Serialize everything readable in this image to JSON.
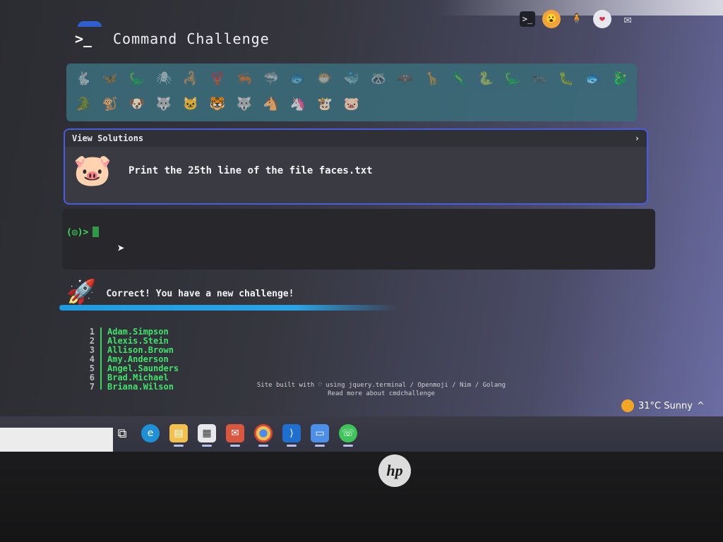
{
  "app": {
    "title": "Command Challenge",
    "logo_glyph": ">_"
  },
  "header_icons": [
    {
      "name": "terminal-icon",
      "glyph": ">_"
    },
    {
      "name": "face-emoji-icon",
      "glyph": "😮"
    },
    {
      "name": "figure-icon",
      "glyph": "🧍"
    },
    {
      "name": "heart-icon",
      "glyph": "❤"
    },
    {
      "name": "mail-icon",
      "glyph": "✉"
    }
  ],
  "emoji_bar": {
    "row1": [
      "🐇",
      "🦋",
      "🦕",
      "🕷",
      "🦂",
      "🦞",
      "🦐",
      "🦈",
      "🐟",
      "🐡",
      "🐳",
      "🦝",
      "🦇",
      "🦒",
      "🦎",
      "🐍",
      "🦕",
      "🐜",
      "🐛",
      "🐟",
      "🐉",
      "🐊",
      "🐒",
      "🐶"
    ],
    "row2": [
      "🐺",
      "🐱",
      "🐯",
      "🐺",
      "🐴",
      "🦄",
      "🐮",
      "🐷"
    ],
    "active_index_row2": 7
  },
  "solutions": {
    "header": "View Solutions",
    "chevron": "›",
    "challenge_emoji": "🐷",
    "challenge_text": "Print the 25th line of the file faces.txt"
  },
  "terminal": {
    "prompt": "(◎)>"
  },
  "result": {
    "rocket": "🚀",
    "message": "Correct! You have a new challenge!",
    "progress": 0.55
  },
  "output_lines": [
    {
      "n": "1",
      "text": "Adam.Simpson"
    },
    {
      "n": "2",
      "text": "Alexis.Stein"
    },
    {
      "n": "3",
      "text": "Allison.Brown"
    },
    {
      "n": "4",
      "text": "Amy.Anderson"
    },
    {
      "n": "5",
      "text": "Angel.Saunders"
    },
    {
      "n": "6",
      "text": "Brad.Michael"
    },
    {
      "n": "7",
      "text": "Briana.Wilson"
    }
  ],
  "footer": {
    "line1": "Site built with ♡ using jquery.terminal / Openmoji / Nim / Golang",
    "line2": "Read more about cmdchallenge"
  },
  "taskbar": {
    "weather": "31°C Sunny",
    "tray_glyph": "^",
    "apps": [
      {
        "name": "task-view",
        "glyph": "⧉",
        "cls": "tasks"
      },
      {
        "name": "edge",
        "glyph": "e",
        "cls": "edge"
      },
      {
        "name": "file-explorer",
        "glyph": "▤",
        "cls": "folder"
      },
      {
        "name": "store",
        "glyph": "▦",
        "cls": "store"
      },
      {
        "name": "mail",
        "glyph": "✉",
        "cls": "mailapp"
      },
      {
        "name": "chrome",
        "glyph": "",
        "cls": "chrome"
      },
      {
        "name": "vscode",
        "glyph": "⟩",
        "cls": "code"
      },
      {
        "name": "notepad",
        "glyph": "▭",
        "cls": "notes"
      },
      {
        "name": "whatsapp",
        "glyph": "☏",
        "cls": "whats"
      }
    ]
  },
  "bezel": {
    "logo": "hp"
  }
}
